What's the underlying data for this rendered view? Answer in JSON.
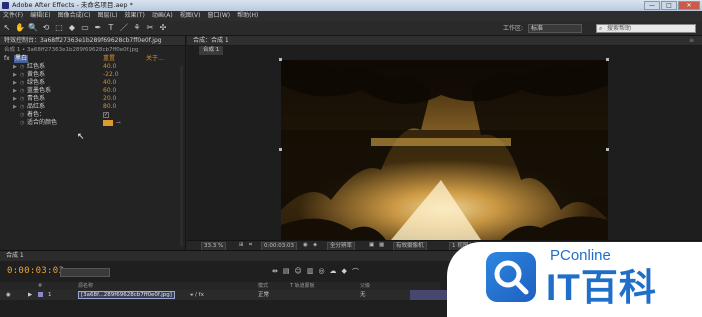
{
  "window": {
    "title": "Adobe After Effects - 未命名项目.aep *",
    "buttons": [
      "—",
      "□",
      "✕"
    ]
  },
  "menu": [
    "文件(F)",
    "编辑(E)",
    "图像合成(C)",
    "图层(L)",
    "效果(T)",
    "动画(A)",
    "视图(V)",
    "窗口(W)",
    "帮助(H)"
  ],
  "toolbar": {
    "tools": [
      "↖",
      "✋",
      "🔍",
      "⟲",
      "⬚",
      "◆",
      "▭",
      "✒",
      "T",
      "／",
      "⚘",
      "✂",
      "✣"
    ],
    "workspace_label": "工作区:",
    "workspace_value": "标准",
    "search_placeholder": "搜索帮助"
  },
  "effect_controls": {
    "tab": "特效控制台：3a68ff27363e1b289f69628cb7ff0e0f.jpg",
    "subtitle": "合成 1 • 3a68ff27363e1b289f69628cb7ff0e0f.jpg",
    "fx_label": "fx",
    "effect_name": "黑白",
    "reset": "重置",
    "about": "关于...",
    "params": [
      {
        "name": "红色系",
        "value": "40.0"
      },
      {
        "name": "黄色系",
        "value": "-22.0"
      },
      {
        "name": "绿色系",
        "value": "40.0"
      },
      {
        "name": "蓝墨色系",
        "value": "60.0"
      },
      {
        "name": "青色系",
        "value": "20.0"
      },
      {
        "name": "品红系",
        "value": "80.0"
      }
    ],
    "tint_label": "着色：",
    "tint_checked": "✓",
    "tint_color_label": "适合的颜色",
    "tint_color": "#e09a2c"
  },
  "composition": {
    "tab": "合成：合成 1",
    "subtab": "合成 1",
    "zoom": "33.3 %",
    "timecode": "0:00:03:03",
    "resolution": "全分辨率",
    "camera": "有效摄像机",
    "views": "1 视图"
  },
  "timeline": {
    "tab": "合成 1",
    "timecode": "0:00:03:03",
    "headers": {
      "num": "#",
      "source": "源名称",
      "mode": "模式",
      "trkmat": "T  轨道蒙板",
      "parent": "父级"
    },
    "layer": {
      "num": "1",
      "name": "[3a68f...289f69628cb7ff0e0f.jpg]",
      "mode": "正常",
      "parent": "无"
    }
  },
  "watermark": {
    "brand": "PConline",
    "name": "IT百科"
  }
}
